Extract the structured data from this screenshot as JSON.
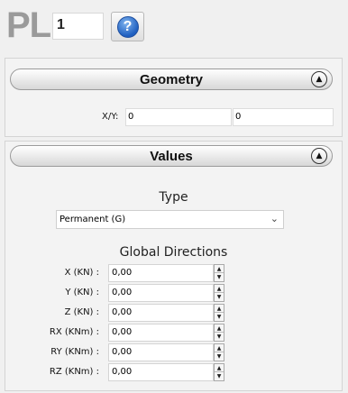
{
  "header": {
    "title": "PL",
    "id_value": "1",
    "help_glyph": "?"
  },
  "geometry": {
    "title": "Geometry",
    "collapse_glyph": "▲",
    "xy_label": "X/Y:",
    "x_value": "0",
    "y_value": "0"
  },
  "values": {
    "title": "Values",
    "collapse_glyph": "▲",
    "type_label": "Type",
    "type_selected": "Permanent (G)",
    "dropdown_glyph": "⌄",
    "global_directions_label": "Global Directions",
    "rows": [
      {
        "label": "X (KN) :",
        "value": "0,00"
      },
      {
        "label": "Y (KN) :",
        "value": "0,00"
      },
      {
        "label": "Z (KN) :",
        "value": "0,00"
      },
      {
        "label": "RX (KNm) :",
        "value": "0,00"
      },
      {
        "label": "RY (KNm) :",
        "value": "0,00"
      },
      {
        "label": "RZ (KNm) :",
        "value": "0,00"
      }
    ],
    "spin_up": "▲",
    "spin_down": "▼"
  },
  "colors": {
    "title_gray": "#9a9a9a",
    "help_blue": "#1f5fc0",
    "panel_bg": "#f3f3f3"
  }
}
